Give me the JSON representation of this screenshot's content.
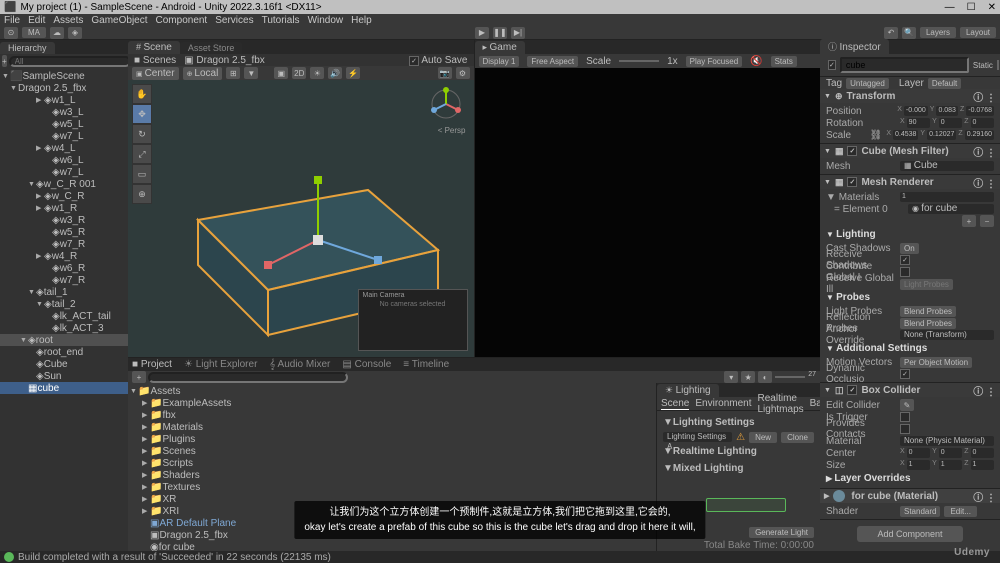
{
  "window": {
    "title": "My project (1) - SampleScene - Android - Unity 2022.3.16f1 <DX11>",
    "minimize": "—",
    "maximize": "☐",
    "close": "✕"
  },
  "menu": [
    "File",
    "Edit",
    "Assets",
    "GameObject",
    "Component",
    "Services",
    "Tutorials",
    "Window",
    "Help"
  ],
  "toolbar": {
    "account": "MA",
    "layers": "Layers",
    "layout": "Layout"
  },
  "playback": {
    "play": "▶",
    "pause": "❚❚",
    "step": "▶|"
  },
  "hierarchy": {
    "tab": "Hierarchy",
    "plus": "+",
    "search_ph": "All",
    "scene": "SampleScene",
    "root": "Dragon 2.5_fbx",
    "items": [
      {
        "n": "w1_L",
        "d": 3
      },
      {
        "n": "w3_L",
        "d": 3
      },
      {
        "n": "w5_L",
        "d": 3
      },
      {
        "n": "w7_L",
        "d": 3
      },
      {
        "n": "w4_L",
        "d": 3
      },
      {
        "n": "w6_L",
        "d": 3
      },
      {
        "n": "w7_L",
        "d": 3
      },
      {
        "n": "w_C_R 001",
        "d": 2
      },
      {
        "n": "w_C_R",
        "d": 3
      },
      {
        "n": "w1_R",
        "d": 3
      },
      {
        "n": "w3_R",
        "d": 3
      },
      {
        "n": "w5_R",
        "d": 3
      },
      {
        "n": "w7_R",
        "d": 3
      },
      {
        "n": "w4_R",
        "d": 3
      },
      {
        "n": "w6_R",
        "d": 3
      },
      {
        "n": "w7_R",
        "d": 3
      },
      {
        "n": "tail_1",
        "d": 2
      },
      {
        "n": "tail_2",
        "d": 3
      },
      {
        "n": "lk_ACT_tail",
        "d": 4
      },
      {
        "n": "lk_ACT_3",
        "d": 4
      },
      {
        "n": "root",
        "d": 1
      },
      {
        "n": "root_end",
        "d": 2
      },
      {
        "n": "Cube",
        "d": 1
      },
      {
        "n": "Sun",
        "d": 1
      }
    ],
    "selected": "cube"
  },
  "scene": {
    "tab_scene": "Scene",
    "tab_asset": "Asset Store",
    "breadcrumb1": "Scenes",
    "breadcrumb2": "Dragon 2.5_fbx",
    "autosave": "Auto Save",
    "center": "Center",
    "local": "Local",
    "persp": "< Persp",
    "camera_prev": "Main Camera",
    "camera_msg": "No cameras selected"
  },
  "game": {
    "tab": "Game",
    "display": "Display 1",
    "aspect": "Free Aspect",
    "scale": "Scale",
    "scale_val": "1x",
    "play_focused": "Play Focused",
    "stats": "Stats"
  },
  "project": {
    "tab_project": "Project",
    "tab_lightexp": "Light Explorer",
    "tab_audio": "Audio Mixer",
    "tab_console": "Console",
    "tab_timeline": "Timeline",
    "assets": "Assets",
    "folders": [
      "ExampleAssets",
      "fbx",
      "Materials",
      "Plugins",
      "Scenes",
      "Scripts",
      "Shaders",
      "Textures",
      "XR",
      "XRI"
    ],
    "files": [
      "AR Default Plane",
      "Dragon 2.5_fbx",
      "for cube"
    ]
  },
  "lighting": {
    "tab": "Lighting",
    "sub_scene": "Scene",
    "sub_env": "Environment",
    "sub_realtime": "Realtime Lightmaps",
    "sub_baked": "Baked",
    "sec_settings": "Lighting Settings",
    "settings_field": "Lighting Settings A",
    "new_btn": "New",
    "clone_btn": "Clone",
    "sec_realtime": "Realtime Lighting",
    "sec_mixed": "Mixed Lighting",
    "generate": "Generate Light",
    "bake_time_label": "Total Bake Time:",
    "bake_time": "0:00:00",
    "drop_hint": ""
  },
  "inspector": {
    "tab": "Inspector",
    "name": "cube",
    "static": "Static",
    "tag_label": "Tag",
    "tag": "Untagged",
    "layer_label": "Layer",
    "layer": "Default",
    "transform": {
      "title": "Transform",
      "pos_label": "Position",
      "pos": {
        "x": "-0.000",
        "y": "0.083",
        "z": "-0.0768"
      },
      "rot_label": "Rotation",
      "rot": {
        "x": "90",
        "y": "0",
        "z": "0"
      },
      "scale_label": "Scale",
      "scale": {
        "x": "0.4538",
        "y": "0.12027",
        "z": "0.29160"
      }
    },
    "mesh_filter": {
      "title": "Cube (Mesh Filter)",
      "mesh_label": "Mesh",
      "mesh": "Cube"
    },
    "mesh_renderer": {
      "title": "Mesh Renderer",
      "materials": "Materials",
      "mat_count": "1",
      "element0_label": "Element 0",
      "element0": "for cube",
      "lighting": "Lighting",
      "cast_label": "Cast Shadows",
      "cast": "On",
      "receive_label": "Receive Shadows",
      "contribute_label": "Contribute Global I",
      "receive_gi_label": "Receive Global Ill",
      "receive_gi": "Light Probes",
      "probes": "Probes",
      "lightprobes_label": "Light Probes",
      "lightprobes": "Blend Probes",
      "reflprobes_label": "Reflection Probes",
      "reflprobes": "Blend Probes",
      "anchor_label": "Anchor Override",
      "anchor": "None (Transform)",
      "additional": "Additional Settings",
      "motion_label": "Motion Vectors",
      "motion": "Per Object Motion",
      "dynocc_label": "Dynamic Occlusio"
    },
    "box_collider": {
      "title": "Box Collider",
      "edit_label": "Edit Collider",
      "trigger_label": "Is Trigger",
      "contacts_label": "Provides Contacts",
      "material_label": "Material",
      "material": "None (Physic Material)",
      "center_label": "Center",
      "center": {
        "x": "0",
        "y": "0",
        "z": "0"
      },
      "size_label": "Size",
      "size": {
        "x": "1",
        "y": "1",
        "z": "1"
      }
    },
    "layer_overrides": "Layer Overrides",
    "material_head": "for cube (Material)",
    "shader_label": "Shader",
    "shader": "Standard",
    "edit_btn": "Edit...",
    "add_component": "Add Component"
  },
  "status": "Build completed with a result of 'Succeeded' in 22 seconds (22135 ms)",
  "subtitle": {
    "line1": "让我们为这个立方体创建一个预制件,这就是立方体,我们把它拖到这里,它会的,",
    "line2": "okay let's create a prefab of this cube so this is the cube let's drag and drop it here it will,"
  },
  "watermark": "Udemy"
}
